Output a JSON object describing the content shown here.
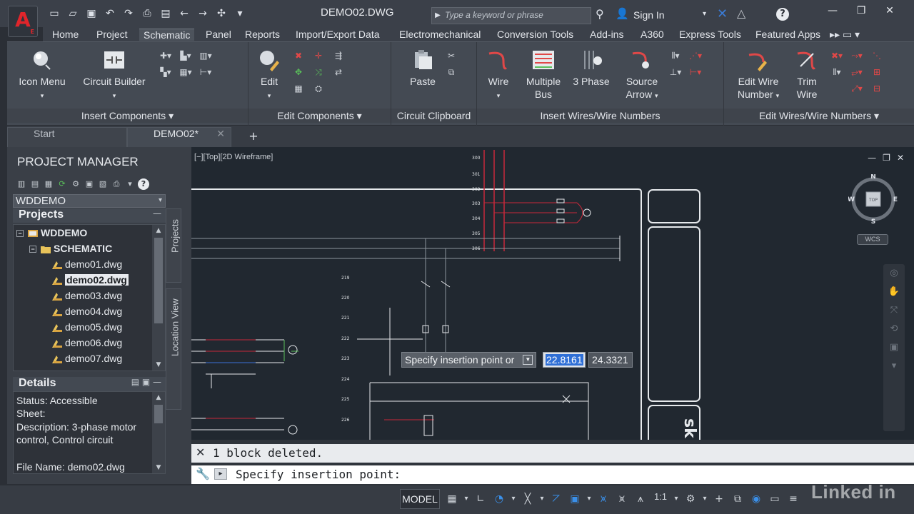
{
  "window": {
    "title": "DEMO02.DWG",
    "search_placeholder": "Type a keyword or phrase",
    "sign_in": "Sign In"
  },
  "app_logo": {
    "letter": "A",
    "sub": "E"
  },
  "ribbon_tabs": [
    "Home",
    "Project",
    "Schematic",
    "Panel",
    "Reports",
    "Import/Export Data",
    "Electromechanical",
    "Conversion Tools",
    "Add-ins",
    "A360",
    "Express Tools",
    "Featured Apps"
  ],
  "active_ribbon_tab": "Schematic",
  "ribbon_panels": {
    "insert_components": {
      "title": "Insert Components",
      "icon_menu": "Icon Menu",
      "circuit_builder": "Circuit Builder"
    },
    "edit_components": {
      "title": "Edit Components",
      "edit": "Edit"
    },
    "circuit_clipboard": {
      "title": "Circuit Clipboard",
      "paste": "Paste"
    },
    "insert_wires": {
      "title": "Insert Wires/Wire Numbers",
      "wire": "Wire",
      "multiple_bus_1": "Multiple",
      "multiple_bus_2": "Bus",
      "three_phase": "3 Phase",
      "source_arrow_1": "Source",
      "source_arrow_2": "Arrow"
    },
    "edit_wires": {
      "title": "Edit Wires/Wire Numbers",
      "edit_wire_number_1": "Edit Wire",
      "edit_wire_number_2": "Number",
      "trim_wire_1": "Trim",
      "trim_wire_2": "Wire"
    }
  },
  "doc_tabs": [
    {
      "label": "Start"
    },
    {
      "label": "DEMO02*"
    }
  ],
  "project_manager": {
    "title": "PROJECT MANAGER",
    "project_select": "WDDEMO",
    "projects_header": "Projects",
    "tree": {
      "root": "WDDEMO",
      "folder": "SCHEMATIC",
      "files": [
        "demo01.dwg",
        "demo02.dwg",
        "demo03.dwg",
        "demo04.dwg",
        "demo05.dwg",
        "demo06.dwg",
        "demo07.dwg"
      ],
      "selected": "demo02.dwg"
    },
    "details_header": "Details",
    "details": {
      "status": "Status: Accessible",
      "sheet": "Sheet:",
      "description_1": "Description: 3-phase motor",
      "description_2": "control, Control circuit",
      "file_name": "File Name: demo02.dwg"
    },
    "side_tabs": {
      "projects": "Projects",
      "location_view": "Location View"
    }
  },
  "viewport": {
    "label": "[−][Top][2D Wireframe]",
    "viewcube": {
      "n": "N",
      "s": "S",
      "e": "E",
      "w": "W",
      "face": "TOP"
    },
    "wcs": "WCS",
    "rung_numbers": [
      "300",
      "301",
      "302",
      "303",
      "304",
      "305",
      "306",
      "219",
      "220",
      "221",
      "222",
      "223",
      "224",
      "225",
      "226"
    ]
  },
  "dynamic_input": {
    "prompt": "Specify insertion point or",
    "x_value": "22.8161",
    "y_value": "24.3321"
  },
  "command_line": {
    "history": "1 block deleted.",
    "current": "Specify insertion point:"
  },
  "status_bar": {
    "model": "MODEL",
    "scale": "1:1"
  },
  "watermark": "Linked in",
  "colors": {
    "accent_blue": "#3a8fe8",
    "logo_red": "#e0252b",
    "wire_red": "#c8283a",
    "wire_green": "#4caf50"
  }
}
